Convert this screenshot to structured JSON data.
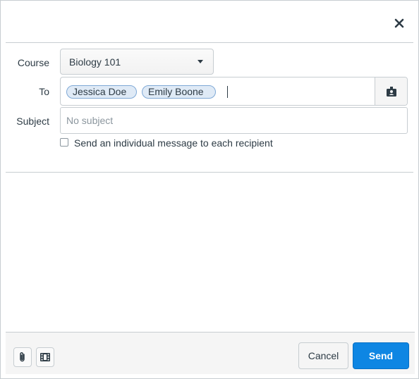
{
  "dialog": {
    "close_icon": "close-icon",
    "course": {
      "label": "Course",
      "selected": "Biology 101"
    },
    "to": {
      "label": "To",
      "recipients": [
        "Jessica Doe",
        "Emily Boone"
      ],
      "address_book_icon": "address-book-icon"
    },
    "subject": {
      "label": "Subject",
      "placeholder": "No subject",
      "value": ""
    },
    "individual": {
      "label": "Send an individual message to each recipient",
      "checked": false
    }
  },
  "footer": {
    "attach_icon": "paperclip-icon",
    "media_icon": "media-icon",
    "cancel_label": "Cancel",
    "send_label": "Send"
  },
  "colors": {
    "accent": "#0e86e3",
    "token_bg": "#dfeaf6",
    "border": "#c7cdd1"
  }
}
